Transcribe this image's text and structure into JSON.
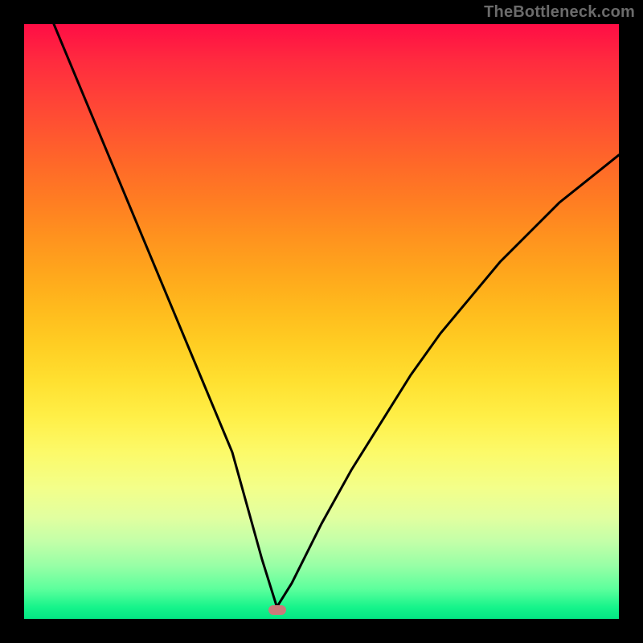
{
  "watermark": {
    "text": "TheBottleneck.com"
  },
  "marker": {
    "xpct": 42.5,
    "ypct": 98.5
  },
  "colors": {
    "curve_stroke": "#000000",
    "marker_fill": "#cc7a7a",
    "frame_bg": "#000000"
  },
  "chart_data": {
    "type": "line",
    "title": "",
    "xlabel": "",
    "ylabel": "",
    "xlim": [
      0,
      100
    ],
    "ylim": [
      0,
      100
    ],
    "series": [
      {
        "name": "bottleneck-curve",
        "x": [
          5,
          10,
          15,
          20,
          25,
          30,
          35,
          40,
          42.5,
          45,
          50,
          55,
          60,
          65,
          70,
          75,
          80,
          85,
          90,
          95,
          100
        ],
        "y": [
          100,
          88,
          76,
          64,
          52,
          40,
          28,
          10,
          2,
          6,
          16,
          25,
          33,
          41,
          48,
          54,
          60,
          65,
          70,
          74,
          78
        ]
      }
    ],
    "annotations": [
      {
        "type": "marker",
        "x": 42.5,
        "y": 1.5,
        "label": ""
      }
    ]
  }
}
